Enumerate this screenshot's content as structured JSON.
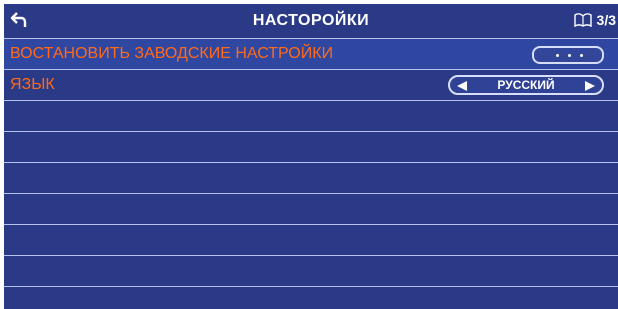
{
  "header": {
    "title": "НАСТОРОЙКИ",
    "page_indicator": "3/3"
  },
  "settings": {
    "reset_label": "ВОСТАНОВИТЬ ЗАВОДСКИЕ НАСТРОЙКИ",
    "language_label": "ЯЗЫК",
    "language_value": "РУССКИЙ"
  },
  "colors": {
    "background": "#2a3a86",
    "label_orange": "#ff6a1a",
    "row_border": "#b8c2ee",
    "text_white": "#ffffff"
  },
  "icons": {
    "back": "back-arrow-icon",
    "page": "open-book-icon",
    "prev": "triangle-left-icon",
    "next": "triangle-right-icon"
  }
}
